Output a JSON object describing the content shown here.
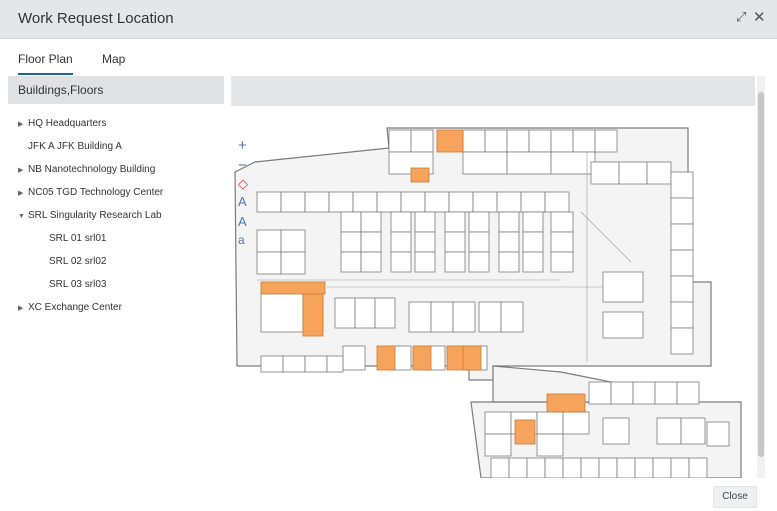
{
  "dialog": {
    "title": "Work Request Location",
    "close_label": "Close"
  },
  "tabs": [
    {
      "label": "Floor Plan",
      "active": true
    },
    {
      "label": "Map",
      "active": false
    }
  ],
  "left_panel": {
    "header": "Buildings,Floors",
    "tree": [
      {
        "label": "HQ Headquarters",
        "expandable": true,
        "expanded": false,
        "level": 0
      },
      {
        "label": "JFK A JFK Building A",
        "expandable": false,
        "level": 0
      },
      {
        "label": "NB Nanotechnology Building",
        "expandable": true,
        "expanded": false,
        "level": 0
      },
      {
        "label": "NC05 TGD Technology Center",
        "expandable": true,
        "expanded": false,
        "level": 0
      },
      {
        "label": "SRL Singularity Research Lab",
        "expandable": true,
        "expanded": true,
        "level": 0
      },
      {
        "label": "SRL 01 srl01",
        "expandable": false,
        "level": 1
      },
      {
        "label": "SRL 02 srl02",
        "expandable": false,
        "level": 1
      },
      {
        "label": "SRL 03 srl03",
        "expandable": false,
        "level": 1
      },
      {
        "label": "XC Exchange Center",
        "expandable": true,
        "expanded": false,
        "level": 0
      }
    ]
  },
  "icons": {
    "expand": "expand-icon",
    "close": "close-icon",
    "zoom_in": "zoom-in-icon",
    "zoom_out": "zoom-out-icon",
    "reset": "reset-view-icon",
    "text_larger": "text-larger-icon",
    "text_smaller": "text-smaller-icon",
    "caret_right": "caret-right-icon",
    "caret_down": "caret-down-icon"
  },
  "colors": {
    "highlight_room": "#f6a45c",
    "tool_blue": "#4a78b5",
    "reset_red": "#d9363e",
    "tab_underline": "#1f5fa8"
  }
}
